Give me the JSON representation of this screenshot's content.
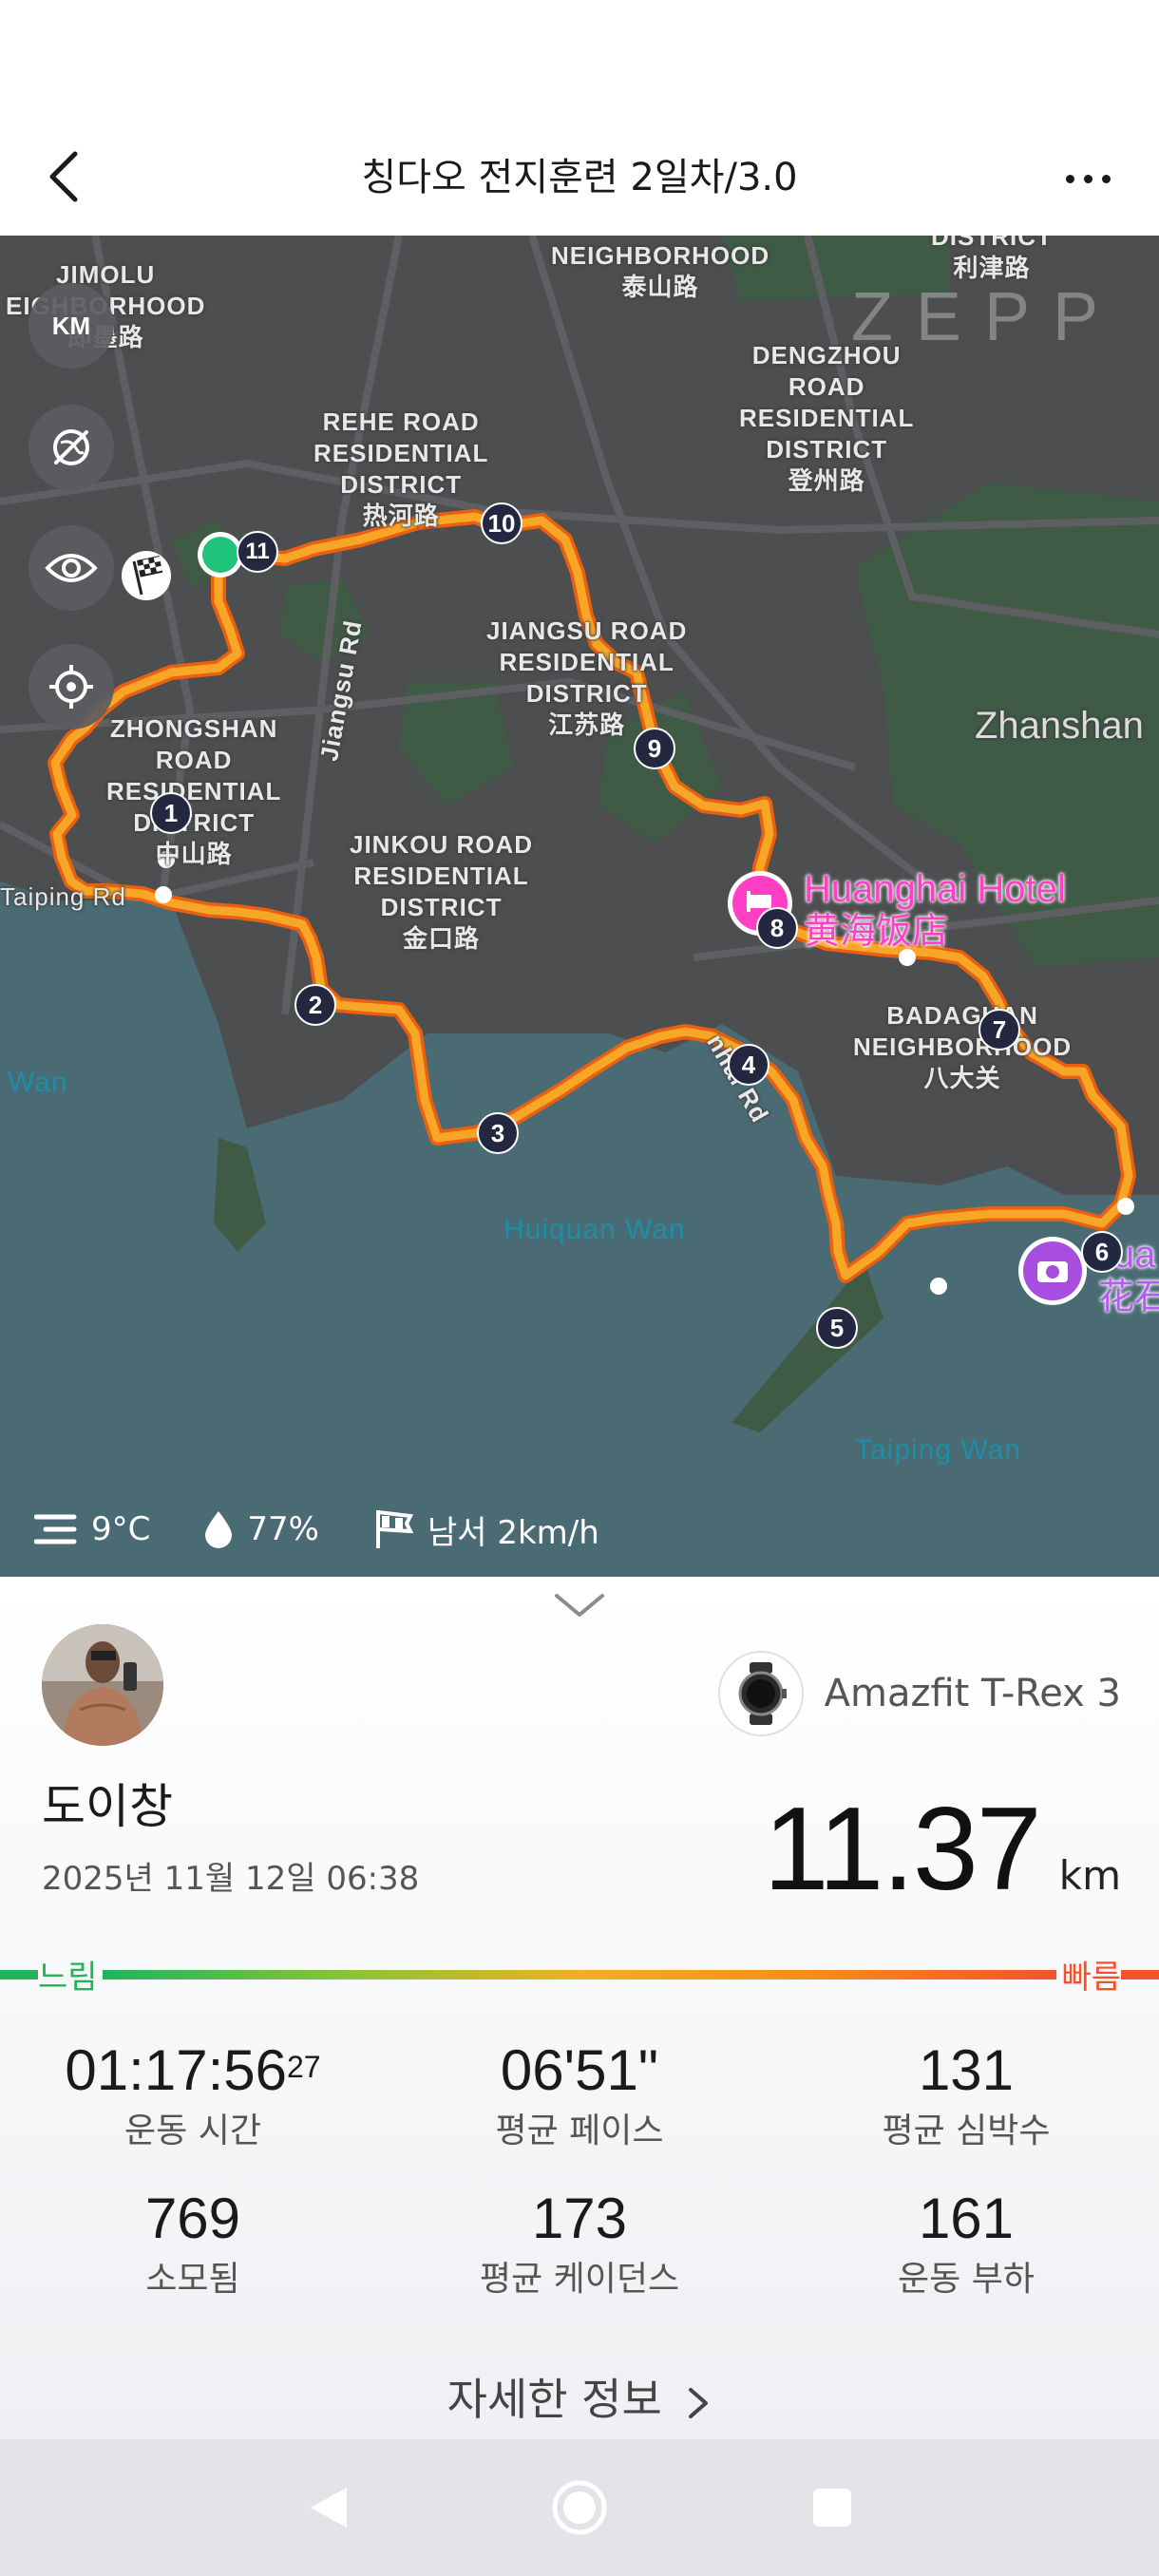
{
  "header": {
    "title": "칭다오 전지훈련 2일차/3.0"
  },
  "map": {
    "unit_button": "KM",
    "logo": "ZEPP",
    "labels": {
      "jimolu": "JIMOLU\nEIGHBORHOOD\n即墨路",
      "neighborhood_top": "NEIGHBORHOOD\n泰山路",
      "district_top_right": "DISTRICT\n利津路",
      "rehe": "REHE ROAD\nRESIDENTIAL\nDISTRICT\n热河路",
      "dengzhou": "DENGZHOU\nROAD\nRESIDENTIAL\nDISTRICT\n登州路",
      "jiangsu_district": "JIANGSU ROAD\nRESIDENTIAL\nDISTRICT\n江苏路",
      "zhanshan": "Zhanshan",
      "zhongshan": "ZHONGSHAN\nROAD\nRESIDENTIAL\nDISTRICT\n中山路",
      "jinkou": "JINKOU ROAD\nRESIDENTIAL\nDISTRICT\n金口路",
      "badaguan": "BADAGUAN\nNEIGHBORHOOD\n八大关",
      "jiangsu_rd": "Jiangsu Rd",
      "taiping_rd": "Taiping Rd",
      "hai_rd": "nhai Rd",
      "wan_left": "Wan",
      "huiquan_wan": "Huiquan Wan",
      "taiping_wan": "Taiping Wan",
      "hotel_name": "Huanghai Hotel",
      "hotel_cn": "黄海饭店",
      "poi_right_top": "ua",
      "poi_right_cn": "花石"
    },
    "km_markers": [
      "1",
      "2",
      "3",
      "4",
      "5",
      "6",
      "7",
      "8",
      "9",
      "10",
      "11"
    ]
  },
  "weather": {
    "temperature": "9°C",
    "humidity": "77%",
    "wind": "남서 2km/h"
  },
  "summary": {
    "device_name": "Amazfit T-Rex 3",
    "user_name": "도이창",
    "date": "2025년 11월 12일 06:38",
    "distance_value": "11.37",
    "distance_unit": "km",
    "pace_slow_label": "느림",
    "pace_fast_label": "빠름"
  },
  "stats": [
    {
      "value": "01:17:56",
      "sup": "27",
      "label": "운동 시간"
    },
    {
      "value": "06'51\"",
      "sup": "",
      "label": "평균 페이스"
    },
    {
      "value": "131",
      "sup": "",
      "label": "평균 심박수"
    },
    {
      "value": "769",
      "sup": "",
      "label": "소모됨"
    },
    {
      "value": "173",
      "sup": "",
      "label": "평균 케이던스"
    },
    {
      "value": "161",
      "sup": "",
      "label": "운동 부하"
    }
  ],
  "details_link": "자세한 정보",
  "colors": {
    "route": "#f39a1a",
    "route_outline": "#e86010",
    "marker_bg": "#232840",
    "hotel": "#ff3fc6",
    "slow": "#1fb45a",
    "fast": "#f3522d",
    "sea": "#4b6b74",
    "land": "#4d4e50",
    "park": "#3f5b46"
  }
}
